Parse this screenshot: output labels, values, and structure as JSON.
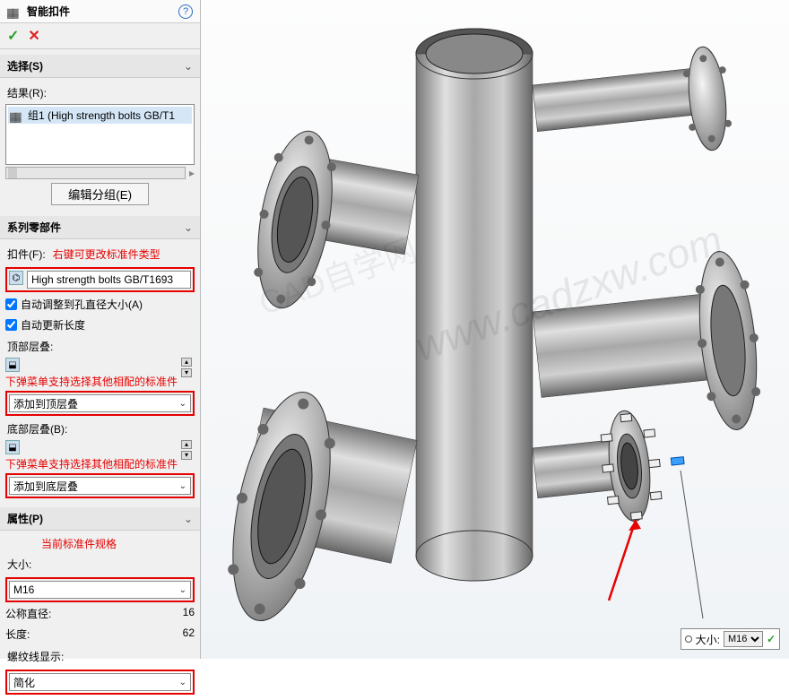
{
  "header": {
    "title": "智能扣件",
    "help": "?"
  },
  "actions": {
    "ok": "✓",
    "cancel": "✕"
  },
  "selection": {
    "label": "选择(S)"
  },
  "results": {
    "label": "结果(R):",
    "item": "组1 (High strength bolts GB/T1",
    "edit_group": "编辑分组(E)"
  },
  "series": {
    "label": "系列零部件",
    "fastener_label": "扣件(F):",
    "annotation1": "右键可更改标准件类型",
    "fastener_value": "High strength bolts GB/T1693",
    "auto_hole": "自动调整到孔直径大小(A)",
    "auto_len": "自动更新长度",
    "top_stack_label": "顶部层叠:",
    "annotation2": "下弹菜单支持选择其他相配的标准件",
    "top_stack_value": "添加到顶层叠",
    "bot_stack_label": "底部层叠(B):",
    "annotation3": "下弹菜单支持选择其他相配的标准件",
    "bot_stack_value": "添加到底层叠"
  },
  "props": {
    "label": "属性(P)",
    "annotation4": "当前标准件规格",
    "size_label": "大小:",
    "size_value": "M16",
    "nominal_label": "公称直径:",
    "nominal_value": "16",
    "length_label": "长度:",
    "length_value": "62",
    "thread_label": "螺纹线显示:",
    "thread_value": "简化"
  },
  "popup": {
    "size_label": "大小:",
    "size_value": "M16",
    "ok": "✓"
  },
  "watermark": {
    "line1": "www.cadzxw.com",
    "line2": "CAD自学网"
  }
}
